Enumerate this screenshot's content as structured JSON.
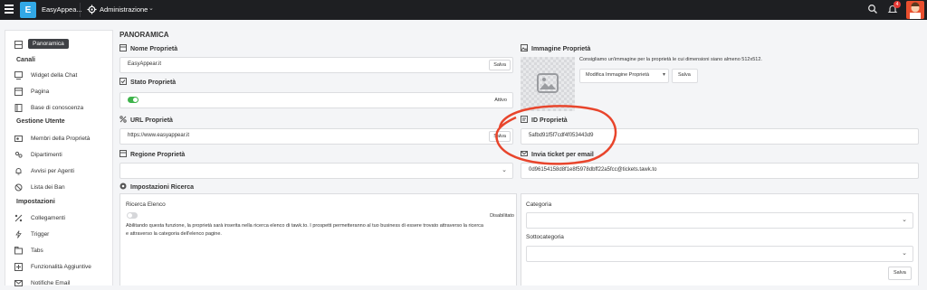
{
  "topbar": {
    "app_logo_letter": "E",
    "app_name": "EasyAppea...",
    "menu_label": "Administrazione",
    "notifications_count": "4"
  },
  "sidebar": {
    "items": [
      {
        "label": "Panoramica",
        "icon": "grid-icon"
      },
      {
        "label": "Widget della Chat",
        "icon": "chat-widget-icon"
      },
      {
        "label": "Pagina",
        "icon": "page-icon"
      },
      {
        "label": "Base di conoscenza",
        "icon": "book-icon"
      },
      {
        "label": "Membri della Proprietà",
        "icon": "members-icon"
      },
      {
        "label": "Dipartimenti",
        "icon": "departments-icon"
      },
      {
        "label": "Avvisi per Agenti",
        "icon": "bell-icon"
      },
      {
        "label": "Lista dei Ban",
        "icon": "ban-icon"
      },
      {
        "label": "Collegamenti",
        "icon": "link-icon"
      },
      {
        "label": "Trigger",
        "icon": "trigger-icon"
      },
      {
        "label": "Tabs",
        "icon": "tabs-icon"
      },
      {
        "label": "Funzionalità Aggiuntive",
        "icon": "addons-icon"
      },
      {
        "label": "Notifiche Email",
        "icon": "mail-icon"
      }
    ],
    "headings": {
      "channels": "Canali",
      "user_mgmt": "Gestione Utente",
      "settings": "Impostazioni"
    }
  },
  "main": {
    "title": "PANORAMICA",
    "property_name": {
      "label": "Nome Proprietà",
      "value": "EasyAppear.it",
      "button": "Salva"
    },
    "property_status": {
      "label": "Stato Proprietà",
      "value": "Attivo",
      "enabled": true
    },
    "property_url": {
      "label": "URL Proprietà",
      "value": "https://www.easyappear.it",
      "button": "Salva"
    },
    "property_region": {
      "label": "Regione Proprietà",
      "value": ""
    },
    "search_settings": {
      "label": "Impostazioni Ricerca",
      "listing_label": "Ricerca Elenco",
      "listing_status": "Disabilitato",
      "listing_enabled": false,
      "description": "Abilitando questa funzione, la proprietà sarà inserita nella ricerca elenco di tawk.to. I prospetti permetteranno al tuo business di essere trovato attraverso la ricerca e attraverso la categoria dell'elenco pagine.",
      "category_label": "Categoria",
      "subcategory_label": "Sottocategoria",
      "button": "Salva"
    },
    "property_image": {
      "label": "Immagine Proprietà",
      "hint": "Consigliamo un'immagine per la proprietà le cui dimensioni siano almeno 512x512.",
      "edit_button": "Modifica Immagine Proprietà",
      "save_button": "Salva"
    },
    "property_id": {
      "label": "ID Proprietà",
      "value": "5afbd91f5f7cdf4f053443d9"
    },
    "ticket_email": {
      "label": "Invia ticket per email",
      "value": "0d96154158d8f1e8f5978dbff22a5fcc@tickets.tawk.to"
    }
  },
  "annotation": {
    "color": "#e8452c"
  }
}
